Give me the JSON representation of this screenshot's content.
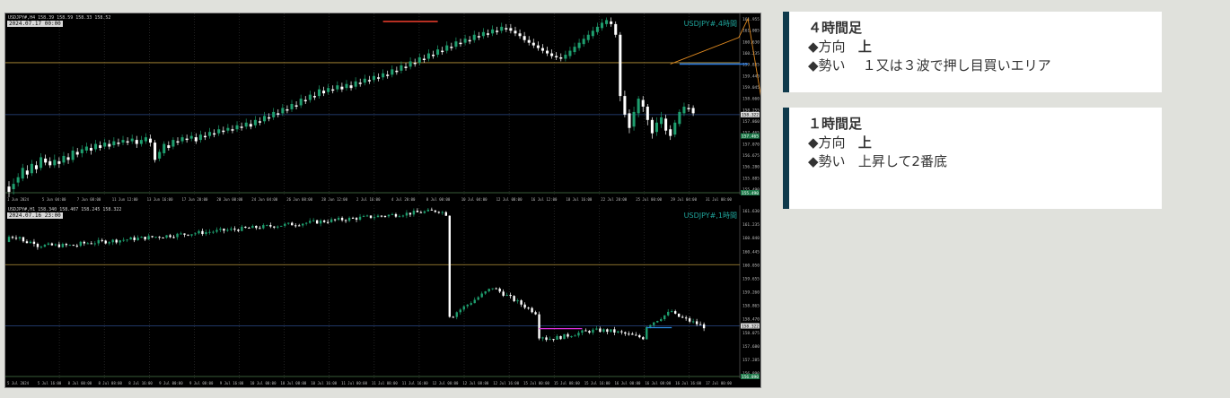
{
  "chart_4h": {
    "symbol_label": "USDJPY#,4時間",
    "header_text": "USDJPY#,H4 158.39 158.59 158.33 158.52",
    "cursor_date": "2024.07.17 00:00",
    "price_labels": [
      "161.955",
      "161.005",
      "160.630",
      "160.235",
      "159.835",
      "159.440",
      "159.045",
      "158.660",
      "158.255",
      "157.860",
      "157.465",
      "157.070",
      "156.675",
      "156.280",
      "155.885",
      "155.490"
    ],
    "time_labels": [
      "1 Jun 2024",
      "5 Jun 04:00",
      "7 Jun 08:00",
      "11 Jun 12:00",
      "13 Jun 16:00",
      "17 Jun 20:00",
      "20 Jun 00:00",
      "24 Jun 04:00",
      "26 Jun 08:00",
      "28 Jun 12:00",
      "2 Jul 16:00",
      "4 Jul 20:00",
      "8 Jul 00:00",
      "10 Jul 04:00",
      "12 Jul 08:00",
      "16 Jul 12:00",
      "18 Jul 16:00",
      "22 Jul 20:00",
      "25 Jul 00:00",
      "29 Jul 04:00",
      "31 Jul 08:00"
    ],
    "bid_price_tag": "158.322",
    "ask_price_tag": "157.465",
    "bottom_price_tag": "155.490",
    "bull_color": "#1e9e6e",
    "bear_color": "#ffffff",
    "candles": [
      [
        155.6,
        155.4,
        155.8,
        155.2
      ],
      [
        155.5,
        155.7,
        155.9,
        155.3
      ],
      [
        155.75,
        155.95,
        156.1,
        155.6
      ],
      [
        155.9,
        156.3,
        156.45,
        155.8
      ],
      [
        156.2,
        156.05,
        156.4,
        155.9
      ],
      [
        156.1,
        156.45,
        156.6,
        156.0
      ],
      [
        156.4,
        156.25,
        156.55,
        156.1
      ],
      [
        156.3,
        156.7,
        156.85,
        156.2
      ],
      [
        156.65,
        156.5,
        156.8,
        156.4
      ],
      [
        156.55,
        156.4,
        156.7,
        156.3
      ],
      [
        156.4,
        156.6,
        156.8,
        156.3
      ],
      [
        156.55,
        156.45,
        156.7,
        156.3
      ],
      [
        156.5,
        156.75,
        156.9,
        156.4
      ],
      [
        156.7,
        156.6,
        156.85,
        156.45
      ],
      [
        156.6,
        156.95,
        157.1,
        156.5
      ],
      [
        156.9,
        156.8,
        157.05,
        156.7
      ],
      [
        156.85,
        157.0,
        157.15,
        156.7
      ],
      [
        156.95,
        157.1,
        157.25,
        156.85
      ],
      [
        157.05,
        156.95,
        157.2,
        156.8
      ],
      [
        157.0,
        157.2,
        157.35,
        156.9
      ],
      [
        157.15,
        157.05,
        157.3,
        156.95
      ],
      [
        157.1,
        157.25,
        157.4,
        157.0
      ],
      [
        157.2,
        157.1,
        157.35,
        157.0
      ],
      [
        157.15,
        157.3,
        157.45,
        157.05
      ],
      [
        157.25,
        157.2,
        157.4,
        157.1
      ],
      [
        157.25,
        157.35,
        157.5,
        157.15
      ],
      [
        157.3,
        157.25,
        157.45,
        157.15
      ],
      [
        157.3,
        157.4,
        157.55,
        157.2
      ],
      [
        157.35,
        157.2,
        157.5,
        157.05
      ],
      [
        157.2,
        157.35,
        157.5,
        157.1
      ],
      [
        157.3,
        157.45,
        157.6,
        157.2
      ],
      [
        157.4,
        157.25,
        157.55,
        157.1
      ],
      [
        157.25,
        156.6,
        157.35,
        156.5
      ],
      [
        156.65,
        156.9,
        157.0,
        156.55
      ],
      [
        156.85,
        157.2,
        157.3,
        156.75
      ],
      [
        157.15,
        157.05,
        157.3,
        156.95
      ],
      [
        157.1,
        157.35,
        157.45,
        157.0
      ],
      [
        157.3,
        157.25,
        157.45,
        157.15
      ],
      [
        157.3,
        157.45,
        157.55,
        157.2
      ],
      [
        157.4,
        157.35,
        157.55,
        157.25
      ],
      [
        157.4,
        157.5,
        157.65,
        157.3
      ],
      [
        157.45,
        157.3,
        157.6,
        157.2
      ],
      [
        157.35,
        157.55,
        157.7,
        157.25
      ],
      [
        157.5,
        157.45,
        157.65,
        157.35
      ],
      [
        157.5,
        157.65,
        157.8,
        157.4
      ],
      [
        157.6,
        157.55,
        157.75,
        157.45
      ],
      [
        157.6,
        157.75,
        157.9,
        157.5
      ],
      [
        157.7,
        157.65,
        157.85,
        157.55
      ],
      [
        157.7,
        157.8,
        157.95,
        157.6
      ],
      [
        157.75,
        157.7,
        157.9,
        157.6
      ],
      [
        157.75,
        157.9,
        158.05,
        157.65
      ],
      [
        157.85,
        157.8,
        158.0,
        157.7
      ],
      [
        157.85,
        158.0,
        158.15,
        157.75
      ],
      [
        157.95,
        157.85,
        158.1,
        157.75
      ],
      [
        157.9,
        158.1,
        158.25,
        157.8
      ],
      [
        158.05,
        158.0,
        158.2,
        157.9
      ],
      [
        158.05,
        158.25,
        158.4,
        157.95
      ],
      [
        158.2,
        158.15,
        158.35,
        158.05
      ],
      [
        158.2,
        158.4,
        158.55,
        158.1
      ],
      [
        158.35,
        158.3,
        158.5,
        158.2
      ],
      [
        158.35,
        158.55,
        158.7,
        158.25
      ],
      [
        158.5,
        158.45,
        158.65,
        158.35
      ],
      [
        158.5,
        158.7,
        158.85,
        158.4
      ],
      [
        158.65,
        158.6,
        158.8,
        158.5
      ],
      [
        158.65,
        158.9,
        159.05,
        158.55
      ],
      [
        158.85,
        158.8,
        159.0,
        158.7
      ],
      [
        158.85,
        159.05,
        159.2,
        158.75
      ],
      [
        159.0,
        158.95,
        159.15,
        158.85
      ],
      [
        159.0,
        159.25,
        159.4,
        158.9
      ],
      [
        159.2,
        159.1,
        159.35,
        159.0
      ],
      [
        159.15,
        159.3,
        159.45,
        159.05
      ],
      [
        159.25,
        159.2,
        159.4,
        159.1
      ],
      [
        159.25,
        159.4,
        159.55,
        159.15
      ],
      [
        159.35,
        159.25,
        159.5,
        159.15
      ],
      [
        159.3,
        159.45,
        159.6,
        159.2
      ],
      [
        159.4,
        159.3,
        159.55,
        159.2
      ],
      [
        159.35,
        159.55,
        159.7,
        159.25
      ],
      [
        159.5,
        159.45,
        159.65,
        159.35
      ],
      [
        159.5,
        159.65,
        159.8,
        159.4
      ],
      [
        159.6,
        159.55,
        159.75,
        159.45
      ],
      [
        159.6,
        159.75,
        159.9,
        159.5
      ],
      [
        159.7,
        159.65,
        159.85,
        159.55
      ],
      [
        159.7,
        159.85,
        160.0,
        159.6
      ],
      [
        159.8,
        159.75,
        159.95,
        159.65
      ],
      [
        159.8,
        160.0,
        160.15,
        159.7
      ],
      [
        159.95,
        159.9,
        160.1,
        159.8
      ],
      [
        159.95,
        160.15,
        160.3,
        159.85
      ],
      [
        160.1,
        160.05,
        160.25,
        159.95
      ],
      [
        160.1,
        160.3,
        160.45,
        160.0
      ],
      [
        160.25,
        160.2,
        160.4,
        160.1
      ],
      [
        160.25,
        160.45,
        160.6,
        160.15
      ],
      [
        160.4,
        160.35,
        160.55,
        160.25
      ],
      [
        160.4,
        160.6,
        160.75,
        160.3
      ],
      [
        160.55,
        160.5,
        160.7,
        160.4
      ],
      [
        160.55,
        160.75,
        160.9,
        160.45
      ],
      [
        160.7,
        160.65,
        160.85,
        160.55
      ],
      [
        160.7,
        160.9,
        161.05,
        160.6
      ],
      [
        160.85,
        160.8,
        161.0,
        160.7
      ],
      [
        160.85,
        161.05,
        161.2,
        160.75
      ],
      [
        161.0,
        160.95,
        161.15,
        160.85
      ],
      [
        161.0,
        161.15,
        161.3,
        160.9
      ],
      [
        161.1,
        161.05,
        161.25,
        160.95
      ],
      [
        161.1,
        161.3,
        161.45,
        161.0
      ],
      [
        161.25,
        161.2,
        161.4,
        161.1
      ],
      [
        161.25,
        161.4,
        161.55,
        161.15
      ],
      [
        161.35,
        161.3,
        161.5,
        161.2
      ],
      [
        161.35,
        161.5,
        161.65,
        161.25
      ],
      [
        161.45,
        161.4,
        161.6,
        161.3
      ],
      [
        161.45,
        161.6,
        161.75,
        161.35
      ],
      [
        161.55,
        161.5,
        161.7,
        161.4
      ],
      [
        161.55,
        161.45,
        161.7,
        161.35
      ],
      [
        161.45,
        161.35,
        161.6,
        161.25
      ],
      [
        161.35,
        161.25,
        161.5,
        161.15
      ],
      [
        161.25,
        161.1,
        161.4,
        161.0
      ],
      [
        161.1,
        161.0,
        161.25,
        160.9
      ],
      [
        161.0,
        160.9,
        161.15,
        160.8
      ],
      [
        160.9,
        160.8,
        161.05,
        160.7
      ],
      [
        160.8,
        160.7,
        160.95,
        160.6
      ],
      [
        160.7,
        160.6,
        160.85,
        160.5
      ],
      [
        160.6,
        160.5,
        160.75,
        160.4
      ],
      [
        160.5,
        160.45,
        160.65,
        160.35
      ],
      [
        160.45,
        160.4,
        160.6,
        160.3
      ],
      [
        160.4,
        160.55,
        160.7,
        160.3
      ],
      [
        160.5,
        160.7,
        160.85,
        160.4
      ],
      [
        160.65,
        160.85,
        161.0,
        160.55
      ],
      [
        160.8,
        161.0,
        161.15,
        160.7
      ],
      [
        160.95,
        161.15,
        161.3,
        160.85
      ],
      [
        161.1,
        161.3,
        161.45,
        161.0
      ],
      [
        161.25,
        161.45,
        161.6,
        161.15
      ],
      [
        161.4,
        161.6,
        161.75,
        161.3
      ],
      [
        161.55,
        161.75,
        161.9,
        161.45
      ],
      [
        161.7,
        161.85,
        161.95,
        161.6
      ],
      [
        161.8,
        161.7,
        161.95,
        161.6
      ],
      [
        161.7,
        161.3,
        161.8,
        161.2
      ],
      [
        161.3,
        159.0,
        161.4,
        158.8
      ],
      [
        159.0,
        158.3,
        159.2,
        158.2
      ],
      [
        158.35,
        157.8,
        158.5,
        157.6
      ],
      [
        157.85,
        158.4,
        158.6,
        157.7
      ],
      [
        158.35,
        158.9,
        159.0,
        158.2
      ],
      [
        158.85,
        158.6,
        159.0,
        158.4
      ],
      [
        158.6,
        158.1,
        158.7,
        157.9
      ],
      [
        158.1,
        157.6,
        158.2,
        157.4
      ],
      [
        157.65,
        158.0,
        158.2,
        157.5
      ],
      [
        157.95,
        158.2,
        158.4,
        157.8
      ],
      [
        158.15,
        157.7,
        158.3,
        157.55
      ],
      [
        157.75,
        157.5,
        157.9,
        157.35
      ],
      [
        157.55,
        158.0,
        158.1,
        157.45
      ],
      [
        157.95,
        158.4,
        158.5,
        157.85
      ],
      [
        158.35,
        158.6,
        158.75,
        158.25
      ],
      [
        158.55,
        158.5,
        158.7,
        158.4
      ],
      [
        158.55,
        158.35,
        158.65,
        158.25
      ]
    ],
    "hline_gold": 160.25,
    "hline_blue": 158.3,
    "red_seg": {
      "i0": 82,
      "i1": 94,
      "y": 161.8
    },
    "blue_seg": {
      "i0": 147,
      "i1": 162,
      "y": 160.2
    },
    "magenta_seg": {
      "i0": 177,
      "i1": 182,
      "y": 158.3
    },
    "zigzag_orange": [
      [
        145,
        160.2
      ],
      [
        160,
        161.2
      ],
      [
        162,
        161.9
      ],
      [
        166,
        157.8
      ],
      [
        168,
        158.9
      ],
      [
        170,
        157.4
      ],
      [
        172,
        158.2
      ],
      [
        174,
        157.2
      ],
      [
        178,
        158.4
      ]
    ]
  },
  "chart_1h": {
    "symbol_label": "USDJPY#,1時間",
    "header_text": "USDJPY#,H1 158.340 158.407 158.245 158.322",
    "cursor_date": "2024.07.16 23:00",
    "price_labels": [
      "161.630",
      "161.235",
      "160.840",
      "160.445",
      "160.050",
      "159.655",
      "159.260",
      "158.865",
      "158.470",
      "158.075",
      "157.680",
      "157.285",
      "156.890"
    ],
    "time_labels": [
      "5 Jul 2024",
      "5 Jul 16:00",
      "8 Jul 00:00",
      "8 Jul 08:00",
      "8 Jul 16:00",
      "9 Jul 00:00",
      "9 Jul 08:00",
      "9 Jul 16:00",
      "10 Jul 00:00",
      "10 Jul 08:00",
      "10 Jul 16:00",
      "11 Jul 00:00",
      "11 Jul 08:00",
      "11 Jul 16:00",
      "12 Jul 00:00",
      "12 Jul 08:00",
      "12 Jul 16:00",
      "15 Jul 00:00",
      "15 Jul 08:00",
      "15 Jul 16:00",
      "16 Jul 00:00",
      "16 Jul 08:00",
      "16 Jul 16:00",
      "17 Jul 00:00"
    ],
    "bid_price_tag": "158.322",
    "bottom_price_tag": "156.890",
    "hline_gold": 160.05,
    "hline_blue": 158.3,
    "magenta_seg": {
      "i0": 148,
      "i1": 160,
      "y": 158.22
    },
    "blue_seg": {
      "i0": 178,
      "i1": 185,
      "y": 158.25
    }
  },
  "card_4h": {
    "title": "４時間足",
    "dir_label": "◆方向",
    "dir_value": "上",
    "force_label": "◆勢い",
    "force_value": "１又は３波で押し目買いエリア"
  },
  "card_1h": {
    "title": "１時間足",
    "dir_label": "◆方向",
    "dir_value": "上",
    "force_label": "◆勢い",
    "force_value": "上昇して2番底"
  }
}
